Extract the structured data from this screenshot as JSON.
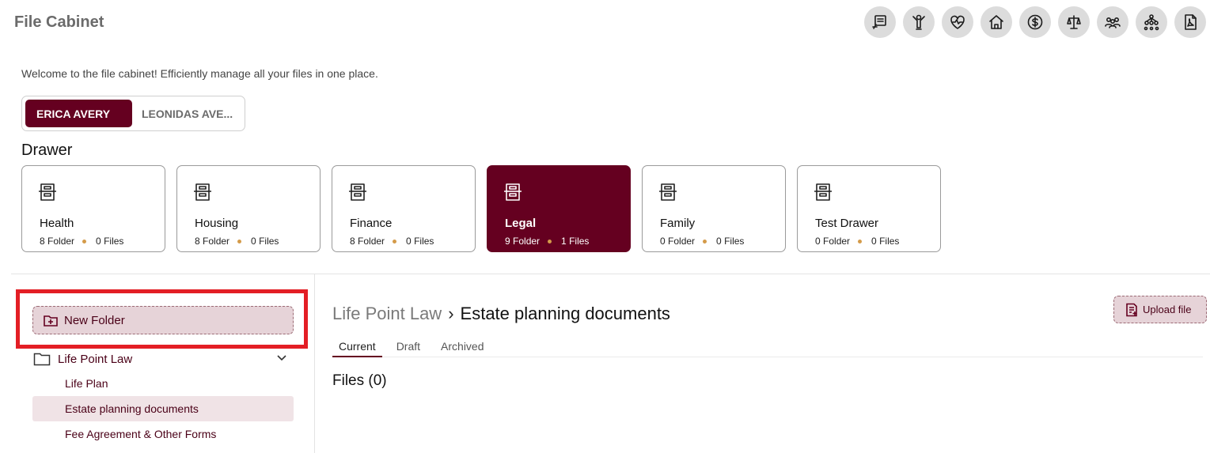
{
  "app": {
    "title": "File Cabinet",
    "welcome": "Welcome to the file cabinet! Efficiently manage all your files in one place."
  },
  "top_icons": [
    {
      "name": "notes-icon"
    },
    {
      "name": "wellness-icon"
    },
    {
      "name": "health-icon"
    },
    {
      "name": "home-icon"
    },
    {
      "name": "finance-icon"
    },
    {
      "name": "legal-scale-icon"
    },
    {
      "name": "family-icon"
    },
    {
      "name": "org-chart-icon"
    },
    {
      "name": "pdf-icon"
    }
  ],
  "people": {
    "active": "ERICA AVERY",
    "other": "LEONIDAS AVE..."
  },
  "drawer": {
    "heading": "Drawer",
    "folder_suffix": "Folder",
    "files_suffix": "Files",
    "cards": [
      {
        "name": "Health",
        "folders": "8",
        "files": "0",
        "active": false
      },
      {
        "name": "Housing",
        "folders": "8",
        "files": "0",
        "active": false
      },
      {
        "name": "Finance",
        "folders": "8",
        "files": "0",
        "active": false
      },
      {
        "name": "Legal",
        "folders": "9",
        "files": "1",
        "active": true
      },
      {
        "name": "Family",
        "folders": "0",
        "files": "0",
        "active": false
      },
      {
        "name": "Test Drawer",
        "folders": "0",
        "files": "0",
        "active": false
      }
    ]
  },
  "sidebar": {
    "new_folder_label": "New Folder",
    "root_folder": "Life Point Law",
    "items": [
      {
        "label": "Life Plan"
      },
      {
        "label": "Estate planning documents"
      },
      {
        "label": "Fee Agreement & Other Forms"
      }
    ]
  },
  "main": {
    "breadcrumb_parent": "Life Point Law",
    "breadcrumb_current": "Estate planning documents",
    "upload_label": "Upload file",
    "tabs": [
      "Current",
      "Draft",
      "Archived"
    ],
    "files_heading": "Files (0)"
  },
  "colors": {
    "brand": "#650020",
    "highlight": "#e31e25",
    "accent_dot": "#d49b4a"
  }
}
